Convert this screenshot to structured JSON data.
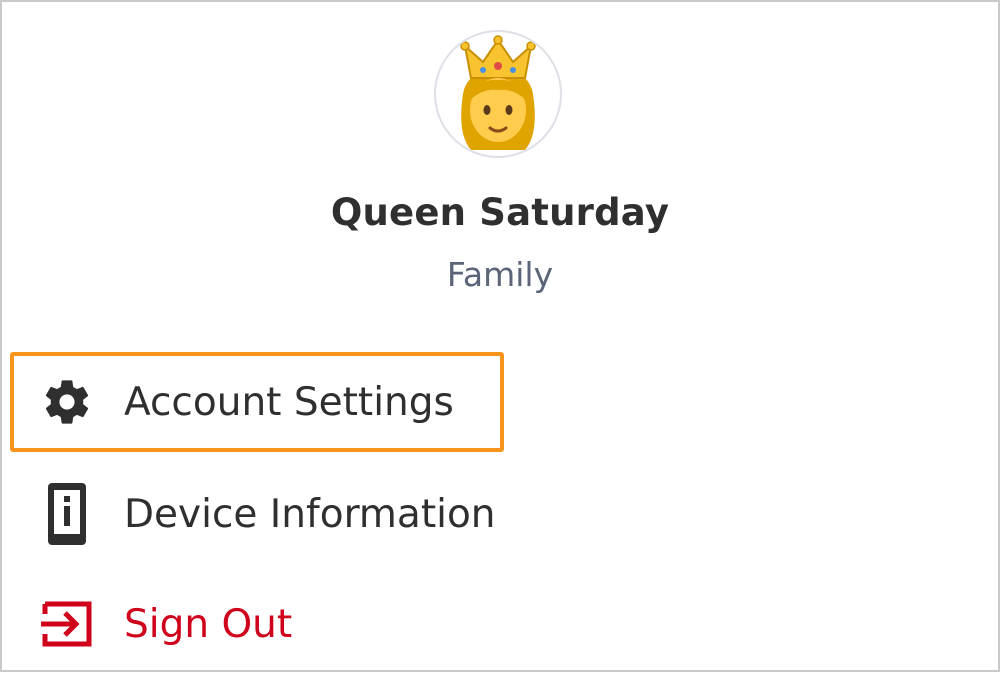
{
  "profile": {
    "name": "Queen Saturday",
    "role": "Family",
    "avatar_icon": "princess-emoji-icon"
  },
  "menu": {
    "items": [
      {
        "label": "Account Settings",
        "icon": "gear-icon",
        "highlighted": true
      },
      {
        "label": "Device Information",
        "icon": "device-info-icon"
      },
      {
        "label": "Sign Out",
        "icon": "sign-out-icon",
        "color": "#d0021b"
      }
    ]
  },
  "colors": {
    "highlight_border": "#f7941d",
    "text_primary": "#2f2f2f",
    "text_secondary": "#5b6478",
    "danger": "#d0021b"
  }
}
